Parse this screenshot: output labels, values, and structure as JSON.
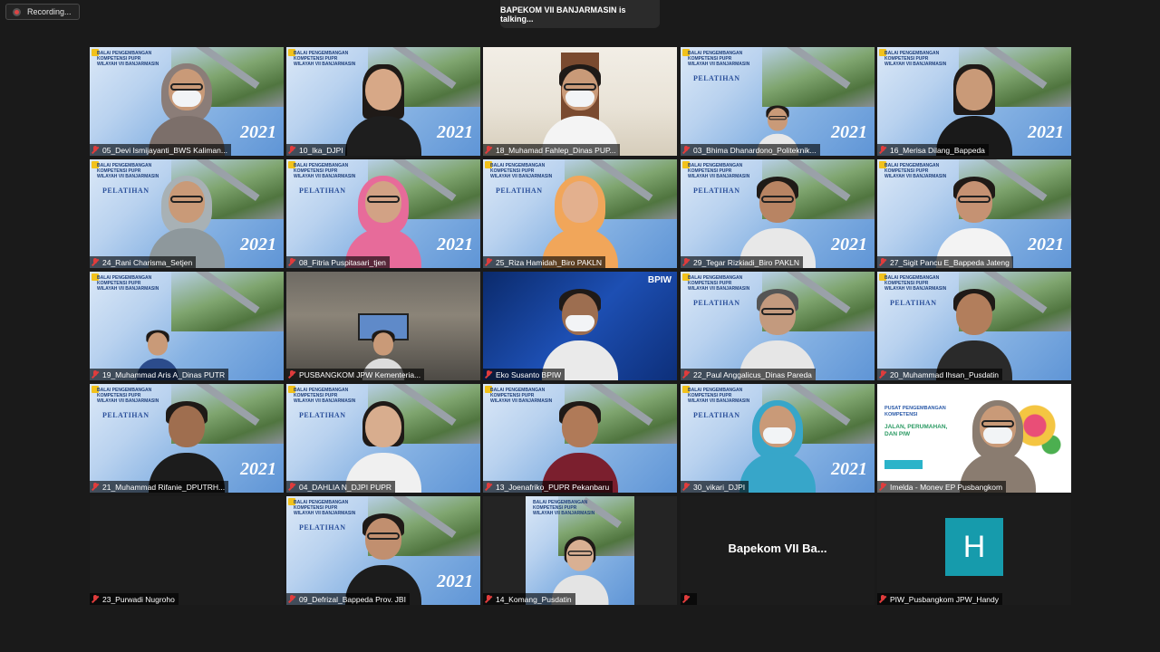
{
  "recording": {
    "label": "Recording..."
  },
  "talking": {
    "label": "BAPEKOM VII BANJARMASIN is talking..."
  },
  "banner": {
    "headline": "BALAI PENGEMBANGAN KOMPETENSI PUPR WILAYAH VII BANJARMASIN",
    "title": "PELATIHAN",
    "year": "2021"
  },
  "bpiw_badge": "BPIW",
  "pusat": {
    "line1": "PUSAT PENGEMBANGAN KOMPETENSI",
    "line2": "JALAN, PERUMAHAN, DAN PIW"
  },
  "participants": [
    {
      "name": "05_Devi Ismijayanti_BWS Kaliman...",
      "muted": true
    },
    {
      "name": "10_Ika_DJPI",
      "muted": true
    },
    {
      "name": "18_Muhamad Fahlep_Dinas PUP...",
      "muted": true
    },
    {
      "name": "03_Bhima Dhanardono_Politeknik...",
      "muted": true
    },
    {
      "name": "16_Merisa Dilang_Bappeda",
      "muted": true
    },
    {
      "name": "24_Rani Charisma_Setjen",
      "muted": true
    },
    {
      "name": "08_Fitria Puspitasari_tjen",
      "muted": true
    },
    {
      "name": "25_Riza Hamidah_Biro PAKLN",
      "muted": true
    },
    {
      "name": "29_Tegar Rizkiadi_Biro PAKLN",
      "muted": true
    },
    {
      "name": "27_Sigit Pancu E_Bappeda Jateng",
      "muted": true
    },
    {
      "name": "19_Muhammad Aris A_Dinas PUTR",
      "muted": true
    },
    {
      "name": "PUSBANGKOM JPW Kementeria...",
      "muted": true
    },
    {
      "name": "Eko Susanto BPIW",
      "muted": true
    },
    {
      "name": "22_Paul Anggalicus_Dinas Pareda",
      "muted": true
    },
    {
      "name": "20_Muhammad Ihsan_Pusdatin",
      "muted": true
    },
    {
      "name": "21_Muhammad Rifanie_DPUTRH...",
      "muted": true
    },
    {
      "name": "04_DAHLIA N_DJPI PUPR",
      "muted": true
    },
    {
      "name": "13_Joenafriko_PUPR Pekanbaru",
      "muted": true
    },
    {
      "name": "30_vikari_DJPI",
      "muted": true
    },
    {
      "name": "Imelda - Monev EP Pusbangkom",
      "muted": true
    },
    {
      "name": "23_Purwadi Nugroho",
      "muted": true
    },
    {
      "name": "09_Defrizal_Bappeda Prov. JBI",
      "muted": true
    },
    {
      "name": "14_Komang_Pusdatin",
      "muted": true
    },
    {
      "name": "Bapekom VII Ba...",
      "muted": true
    },
    {
      "name": "PIW_Pusbangkom JPW_Handy",
      "muted": true
    }
  ],
  "avatar_letter": "H",
  "colors": {
    "mic_muted": "#e03c3c",
    "avatar_bg": "#169bac",
    "background": "#1a1a1a"
  }
}
